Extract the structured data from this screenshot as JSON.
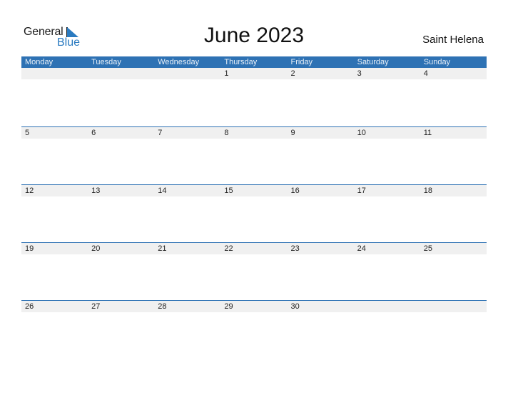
{
  "brand": {
    "general": "General",
    "blue": "Blue",
    "accent_color": "#2e72b4"
  },
  "title": "June 2023",
  "region": "Saint Helena",
  "weekdays": [
    "Monday",
    "Tuesday",
    "Wednesday",
    "Thursday",
    "Friday",
    "Saturday",
    "Sunday"
  ],
  "weeks": [
    [
      "",
      "",
      "",
      "1",
      "2",
      "3",
      "4"
    ],
    [
      "5",
      "6",
      "7",
      "8",
      "9",
      "10",
      "11"
    ],
    [
      "12",
      "13",
      "14",
      "15",
      "16",
      "17",
      "18"
    ],
    [
      "19",
      "20",
      "21",
      "22",
      "23",
      "24",
      "25"
    ],
    [
      "26",
      "27",
      "28",
      "29",
      "30",
      "",
      ""
    ]
  ]
}
